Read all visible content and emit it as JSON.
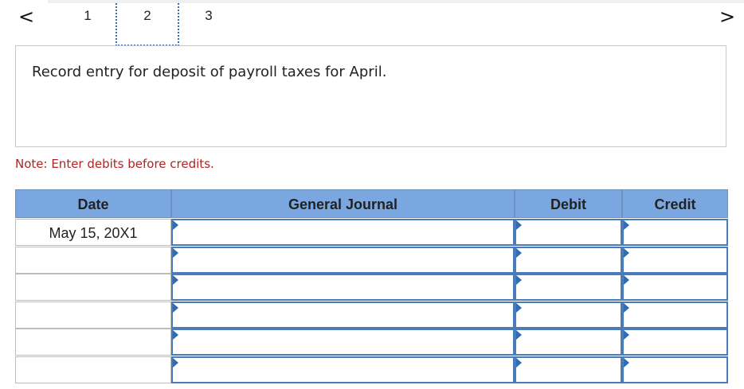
{
  "nav": {
    "prev_arrow": "<",
    "next_arrow": ">",
    "tabs": [
      "1",
      "2",
      "3"
    ],
    "active_tab": "2"
  },
  "question": {
    "text": "Record entry for deposit of payroll taxes for April."
  },
  "note": "Note: Enter debits before credits.",
  "journal": {
    "headers": {
      "date": "Date",
      "account": "General Journal",
      "debit": "Debit",
      "credit": "Credit"
    },
    "rows": [
      {
        "date": "May 15, 20X1",
        "account": "",
        "debit": "",
        "credit": ""
      },
      {
        "date": "",
        "account": "",
        "debit": "",
        "credit": ""
      },
      {
        "date": "",
        "account": "",
        "debit": "",
        "credit": ""
      },
      {
        "date": "",
        "account": "",
        "debit": "",
        "credit": ""
      },
      {
        "date": "",
        "account": "",
        "debit": "",
        "credit": ""
      },
      {
        "date": "",
        "account": "",
        "debit": "",
        "credit": ""
      }
    ]
  },
  "colors": {
    "header_bg": "#7aa7e0",
    "input_border": "#4a7bbb",
    "note_text": "#b22222"
  }
}
